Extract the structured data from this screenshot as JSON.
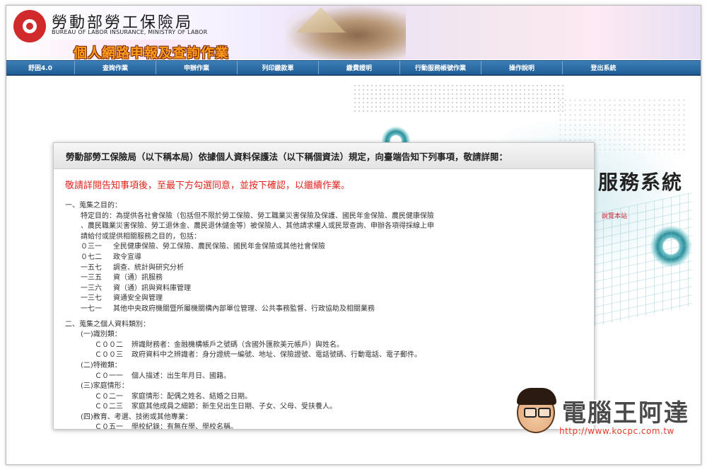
{
  "header": {
    "org_name": "勞動部勞工保險局",
    "org_name_en": "BUREAU OF LABOR INSURANCE, MINISTRY OF LABOR",
    "system_title": "個人網路申報及查詢作業"
  },
  "nav": {
    "items": [
      {
        "label": "舒困4.0"
      },
      {
        "label": "查詢作業"
      },
      {
        "label": "申辦作業"
      },
      {
        "label": "列印繳款單"
      },
      {
        "label": "繳費證明"
      },
      {
        "label": "行動服務帳號作業"
      },
      {
        "label": "操作說明"
      },
      {
        "label": "登出系統"
      }
    ]
  },
  "background": {
    "title_fragment": "服務系統",
    "link_fragment": "說覽本站"
  },
  "modal": {
    "title": "勞動部勞工保險局（以下稱本局）依據個人資料保護法（以下稱個資法）規定，向臺端告知下列事項，敬請詳閱：",
    "alert": "敬請詳閱告知事項後，至最下方勾選同意，並按下確認，以繼續作業。",
    "section1": {
      "heading": "一、蒐集之目的：",
      "purpose_lines": [
        "特定目的：為提供各社會保險（包括但不限於勞工保險、勞工職業災害保險及保護、國民年金保險、農民健康保險",
        "、農民職業災害保險、勞工退休金、農民退休儲金等）被保險人、其他請求權人或民眾查詢、申辦各項得採線上申",
        "請給付或提供相關服務之目的，包括："
      ],
      "codes": [
        {
          "code": "０三一",
          "desc": "全民健康保險、勞工保險、農民保險、國民年金保險或其他社會保險"
        },
        {
          "code": "０七二",
          "desc": "政令宣導"
        },
        {
          "code": "一五七",
          "desc": "調查、統計與研究分析"
        },
        {
          "code": "一三五",
          "desc": "資（通）訊服務"
        },
        {
          "code": "一三六",
          "desc": "資（通）訊與資料庫管理"
        },
        {
          "code": "一三七",
          "desc": "資通安全與管理"
        },
        {
          "code": "一七一",
          "desc": "其他中央政府機關暨所屬機關構內部單位管理、公共事務監督、行政協助及相關業務"
        }
      ]
    },
    "section2": {
      "heading": "二、蒐集之個人資料類別：",
      "groups": [
        {
          "label": "(一)識別類：",
          "items": [
            {
              "code": "Ｃ００二",
              "desc": "辨識財務者：金融機構帳戶之號碼（含國外匯款美元帳戶）與姓名。"
            },
            {
              "code": "Ｃ００三",
              "desc": "政府資料中之辨識者：身分證統一編號、地址、保險證號、電話號碼、行動電話、電子郵件。"
            }
          ]
        },
        {
          "label": "(二)特徵類：",
          "items": [
            {
              "code": "Ｃ０一一",
              "desc": "個人描述：出生年月日、國籍。"
            }
          ]
        },
        {
          "label": "(三)家庭情形：",
          "items": [
            {
              "code": "Ｃ０二一",
              "desc": "家庭情形：配偶之姓名、結婚之日期。"
            },
            {
              "code": "Ｃ０二三",
              "desc": "家庭其他成員之細節：新生兒出生日期、子女、父母、受扶養人。"
            }
          ]
        },
        {
          "label": "(四)教育、考選、技術或其他專業：",
          "items": [
            {
              "code": "Ｃ０五一",
              "desc": "學校紀錄：有無在學、學校名稱。"
            }
          ]
        }
      ]
    }
  },
  "watermark": {
    "text": "電腦王阿達",
    "url": "http://www.kocpc.com.tw"
  },
  "colors": {
    "nav_bg": "#2a6aa6",
    "alert": "#e0241c",
    "title_orange": "#ff9c1a",
    "logo_red": "#d12a2a"
  }
}
